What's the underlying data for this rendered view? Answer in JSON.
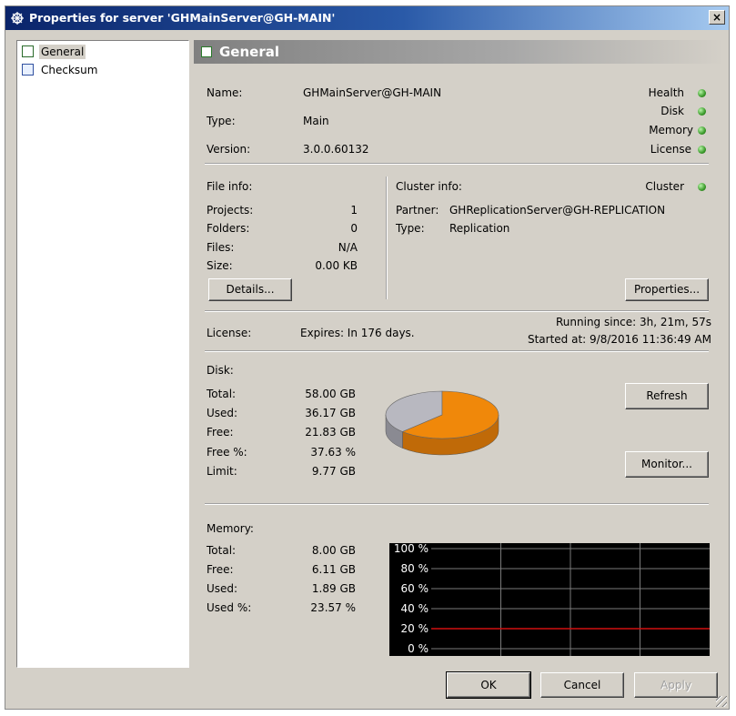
{
  "window": {
    "title": "Properties for server 'GHMainServer@GH-MAIN'",
    "close": "×"
  },
  "tree": {
    "items": [
      {
        "label": "General",
        "selected": true
      },
      {
        "label": "Checksum",
        "selected": false
      }
    ]
  },
  "panel": {
    "title": "General"
  },
  "server": {
    "name_label": "Name:",
    "name": "GHMainServer@GH-MAIN",
    "type_label": "Type:",
    "type": "Main",
    "version_label": "Version:",
    "version": "3.0.0.60132"
  },
  "status": {
    "health": "Health",
    "disk": "Disk",
    "memory": "Memory",
    "license": "License",
    "cluster": "Cluster",
    "color": "#3a9a2a"
  },
  "file_info": {
    "heading": "File info:",
    "projects_label": "Projects:",
    "projects": "1",
    "folders_label": "Folders:",
    "folders": "0",
    "files_label": "Files:",
    "files": "N/A",
    "size_label": "Size:",
    "size": "0.00 KB",
    "details_button": "Details..."
  },
  "cluster_info": {
    "heading": "Cluster info:",
    "partner_label": "Partner:",
    "partner": "GHReplicationServer@GH-REPLICATION",
    "type_label": "Type:",
    "type": "Replication",
    "properties_button": "Properties..."
  },
  "license": {
    "label": "License:",
    "value": "Expires: In 176 days.",
    "running": "Running since: 3h, 21m, 57s",
    "started": "Started at: 9/8/2016 11:36:49 AM"
  },
  "disk": {
    "heading": "Disk:",
    "total_label": "Total:",
    "total": "58.00 GB",
    "used_label": "Used:",
    "used": "36.17 GB",
    "free_label": "Free:",
    "free": "21.83 GB",
    "freepct_label": "Free %:",
    "freepct": "37.63 %",
    "limit_label": "Limit:",
    "limit": "9.77 GB",
    "used_fraction": 0.6237,
    "used_color": "#f0880a",
    "free_color": "#b8b8c0",
    "refresh_button": "Refresh",
    "monitor_button": "Monitor..."
  },
  "memory": {
    "heading": "Memory:",
    "total_label": "Total:",
    "total": "8.00 GB",
    "free_label": "Free:",
    "free": "6.11 GB",
    "used_label": "Used:",
    "used": "1.89 GB",
    "usedpct_label": "Used %:",
    "usedpct": "23.57 %",
    "chart_ticks": [
      "100 %",
      "80 %",
      "60 %",
      "40 %",
      "20 %",
      "0 %"
    ],
    "usage_level_percent": 20,
    "line_color": "#d01010"
  },
  "buttons": {
    "ok": "OK",
    "cancel": "Cancel",
    "apply": "Apply"
  }
}
